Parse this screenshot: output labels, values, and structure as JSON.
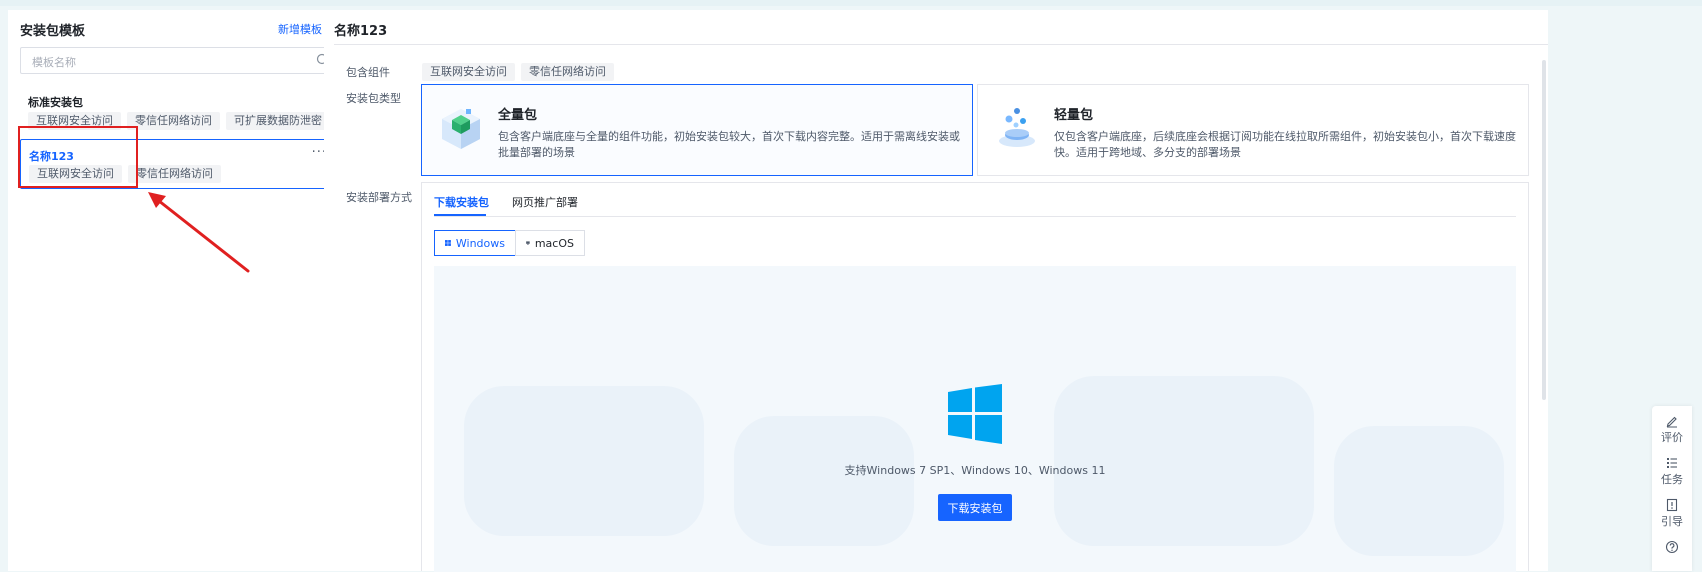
{
  "left_panel": {
    "title": "安装包模板",
    "add_label": "新增模板",
    "collapse_icon": "collapse-left-icon",
    "search": {
      "placeholder": "模板名称",
      "value": "",
      "icon": "search-icon"
    },
    "templates": [
      {
        "name": "标准安装包",
        "tags": [
          "互联网安全访问",
          "零信任网络访问",
          "可扩展数据防泄密"
        ],
        "selected": false
      },
      {
        "name": "名称123",
        "tags": [
          "互联网安全访问",
          "零信任网络访问"
        ],
        "selected": true,
        "more": "···"
      }
    ]
  },
  "detail": {
    "title": "名称123",
    "components_label": "包含组件",
    "components": [
      "互联网安全访问",
      "零信任网络访问"
    ],
    "type_label": "安装包类型",
    "package_types": [
      {
        "name": "全量包",
        "icon": "full-package-icon",
        "selected": true,
        "desc": "包含客户端底座与全量的组件功能，初始安装包较大，首次下载内容完整。适用于需离线安装或批量部署的场景"
      },
      {
        "name": "轻量包",
        "icon": "light-package-icon",
        "selected": false,
        "desc": "仅包含客户端底座，后续底座会根据订阅功能在线拉取所需组件，初始安装包小，首次下载速度快。适用于跨地域、多分支的部署场景"
      }
    ],
    "deploy_label": "安装部署方式",
    "tabs": [
      {
        "label": "下载安装包",
        "active": true
      },
      {
        "label": "网页推广部署",
        "active": false
      }
    ],
    "os_options": [
      {
        "label": "Windows",
        "icon": "windows-icon",
        "active": true
      },
      {
        "label": "macOS",
        "icon": "mac-monitor-icon",
        "active": false
      }
    ],
    "support_text": "支持Windows 7 SP1、Windows 10、Windows 11",
    "download_button": "下载安装包"
  },
  "floating_toolbar": [
    {
      "label": "评价",
      "icon": "pen-icon"
    },
    {
      "label": "任务",
      "icon": "list-icon"
    },
    {
      "label": "引导",
      "icon": "guide-icon"
    },
    {
      "label": "",
      "icon": "help-icon"
    }
  ],
  "colors": {
    "accent": "#1664ff",
    "annotation": "#e02020",
    "windows_blue": "#00a4ef"
  }
}
